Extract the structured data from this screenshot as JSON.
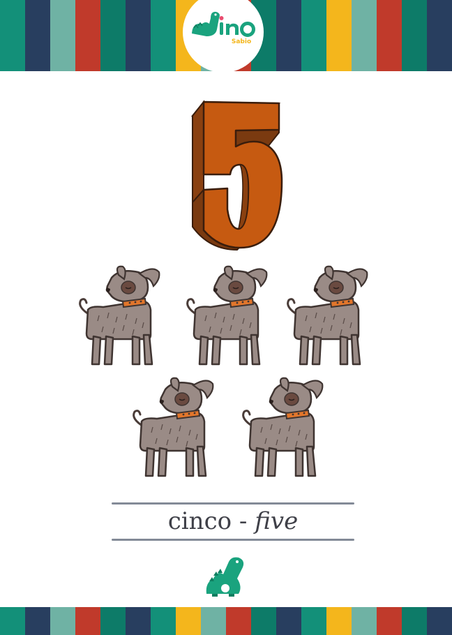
{
  "brand": {
    "name": "dino",
    "subtitle": "Sabio"
  },
  "card": {
    "number": "5",
    "count": 5,
    "word_es": "cinco",
    "separator": "-",
    "word_en": "five",
    "animal_icon": "dog-icon",
    "number_color": "#c65a11"
  },
  "stripe_colors": [
    "#139079",
    "#283e5f",
    "#6fb2a4",
    "#c03a2b",
    "#0d7b68",
    "#283e5f",
    "#139079",
    "#f4b61c",
    "#6fb2a4",
    "#c03a2b",
    "#0d7b68",
    "#283e5f",
    "#139079",
    "#f4b61c",
    "#6fb2a4",
    "#c03a2b",
    "#0d7b68",
    "#283e5f"
  ],
  "colors": {
    "dino_green": "#1aa37e",
    "dino_pink": "#e94c6f",
    "dog_fur": "#9a8b86",
    "dog_collar": "#e2762b"
  }
}
